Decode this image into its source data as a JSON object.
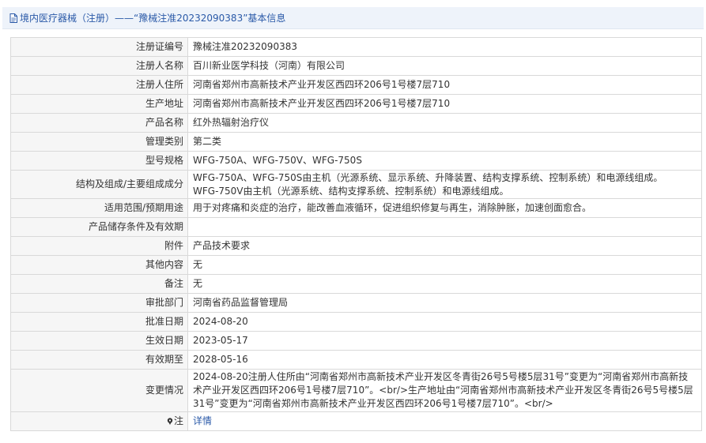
{
  "header": {
    "icon": "document-icon",
    "title": "境内医疗器械（注册）——“豫械注准20232090383”基本信息"
  },
  "rows": [
    {
      "label": "注册证编号",
      "value": "豫械注准20232090383"
    },
    {
      "label": "注册人名称",
      "value": "百川新业医学科技（河南）有限公司"
    },
    {
      "label": "注册人住所",
      "value": "河南省郑州市高新技术产业开发区西四环206号1号楼7层710"
    },
    {
      "label": "生产地址",
      "value": "河南省郑州市高新技术产业开发区西四环206号1号楼7层710"
    },
    {
      "label": "产品名称",
      "value": "红外热辐射治疗仪"
    },
    {
      "label": "管理类别",
      "value": "第二类"
    },
    {
      "label": "型号规格",
      "value": "WFG-750A、WFG-750V、WFG-750S"
    },
    {
      "label": "结构及组成/主要组成成分",
      "value_lines": [
        "WFG-750A、WFG-750S由主机（光源系统、显示系统、升降装置、结构支撑系统、控制系统）和电源线组成。",
        "WFG-750V由主机（光源系统、结构支撑系统、控制系统）和电源线组成。"
      ]
    },
    {
      "label": "适用范围/预期用途",
      "value": "用于对疼痛和炎症的治疗，能改善血液循环，促进组织修复与再生，消除肿胀，加速创面愈合。"
    },
    {
      "label": "产品储存条件及有效期",
      "value": ""
    },
    {
      "label": "附件",
      "value": "产品技术要求"
    },
    {
      "label": "其他内容",
      "value": "无"
    },
    {
      "label": "备注",
      "value": "无"
    },
    {
      "label": "审批部门",
      "value": "河南省药品监督管理局"
    },
    {
      "label": "批准日期",
      "value": "2024-08-20"
    },
    {
      "label": "生效日期",
      "value": "2023-05-17"
    },
    {
      "label": "有效期至",
      "value": "2028-05-16"
    },
    {
      "label": "变更情况",
      "value": "2024-08-20注册人住所由“河南省郑州市高新技术产业开发区冬青街26号5号楼5层31号”变更为“河南省郑州市高新技术产业开发区西四环206号1号楼7层710”。<br/>生产地址由“河南省郑州市高新技术产业开发区冬青街26号5号楼5层31号”变更为“河南省郑州市高新技术产业开发区西四环206号1号楼7层710”。<br/>"
    }
  ],
  "note": {
    "icon": "pin-icon",
    "label": "注",
    "link_text": "详情"
  }
}
